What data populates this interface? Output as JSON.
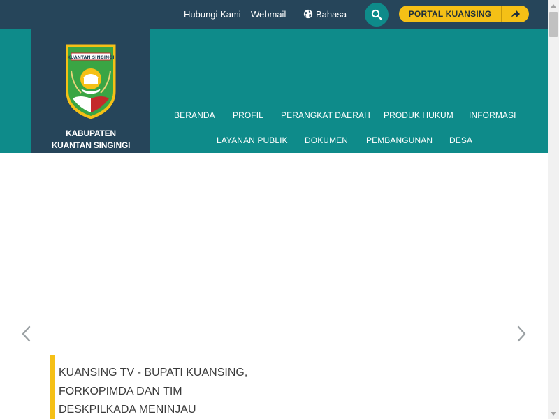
{
  "topbar": {
    "links": [
      {
        "label": "Hubungi Kami"
      },
      {
        "label": "Webmail"
      },
      {
        "label": "Bahasa"
      }
    ],
    "portal_label": "PORTAL KUANSING"
  },
  "logo": {
    "crest_text": "KUANTAN SINGINGI",
    "site_name_line1": "KABUPATEN",
    "site_name_line2": "KUANTAN SINGINGI"
  },
  "nav": {
    "items": [
      {
        "label": "BERANDA"
      },
      {
        "label": "PROFIL"
      },
      {
        "label": "PERANGKAT DAERAH"
      },
      {
        "label": "PRODUK HUKUM"
      },
      {
        "label": "INFORMASI"
      },
      {
        "label": "LAYANAN PUBLIK"
      },
      {
        "label": "DOKUMEN"
      },
      {
        "label": "PEMBANGUNAN"
      },
      {
        "label": "DESA"
      }
    ]
  },
  "hero": {
    "caption_lines": [
      "KUANSING TV - BUPATI KUANSING,",
      "FORKOPIMDA DAN TIM",
      "DESKPILKADA MENINJAU"
    ]
  },
  "colors": {
    "header_dark": "#26455a",
    "teal": "#0e8b8a",
    "accent_yellow": "#f5c016"
  },
  "icons": [
    "globe-icon",
    "search-icon",
    "arrow-right-icon",
    "chevron-left-icon",
    "chevron-right-icon"
  ]
}
